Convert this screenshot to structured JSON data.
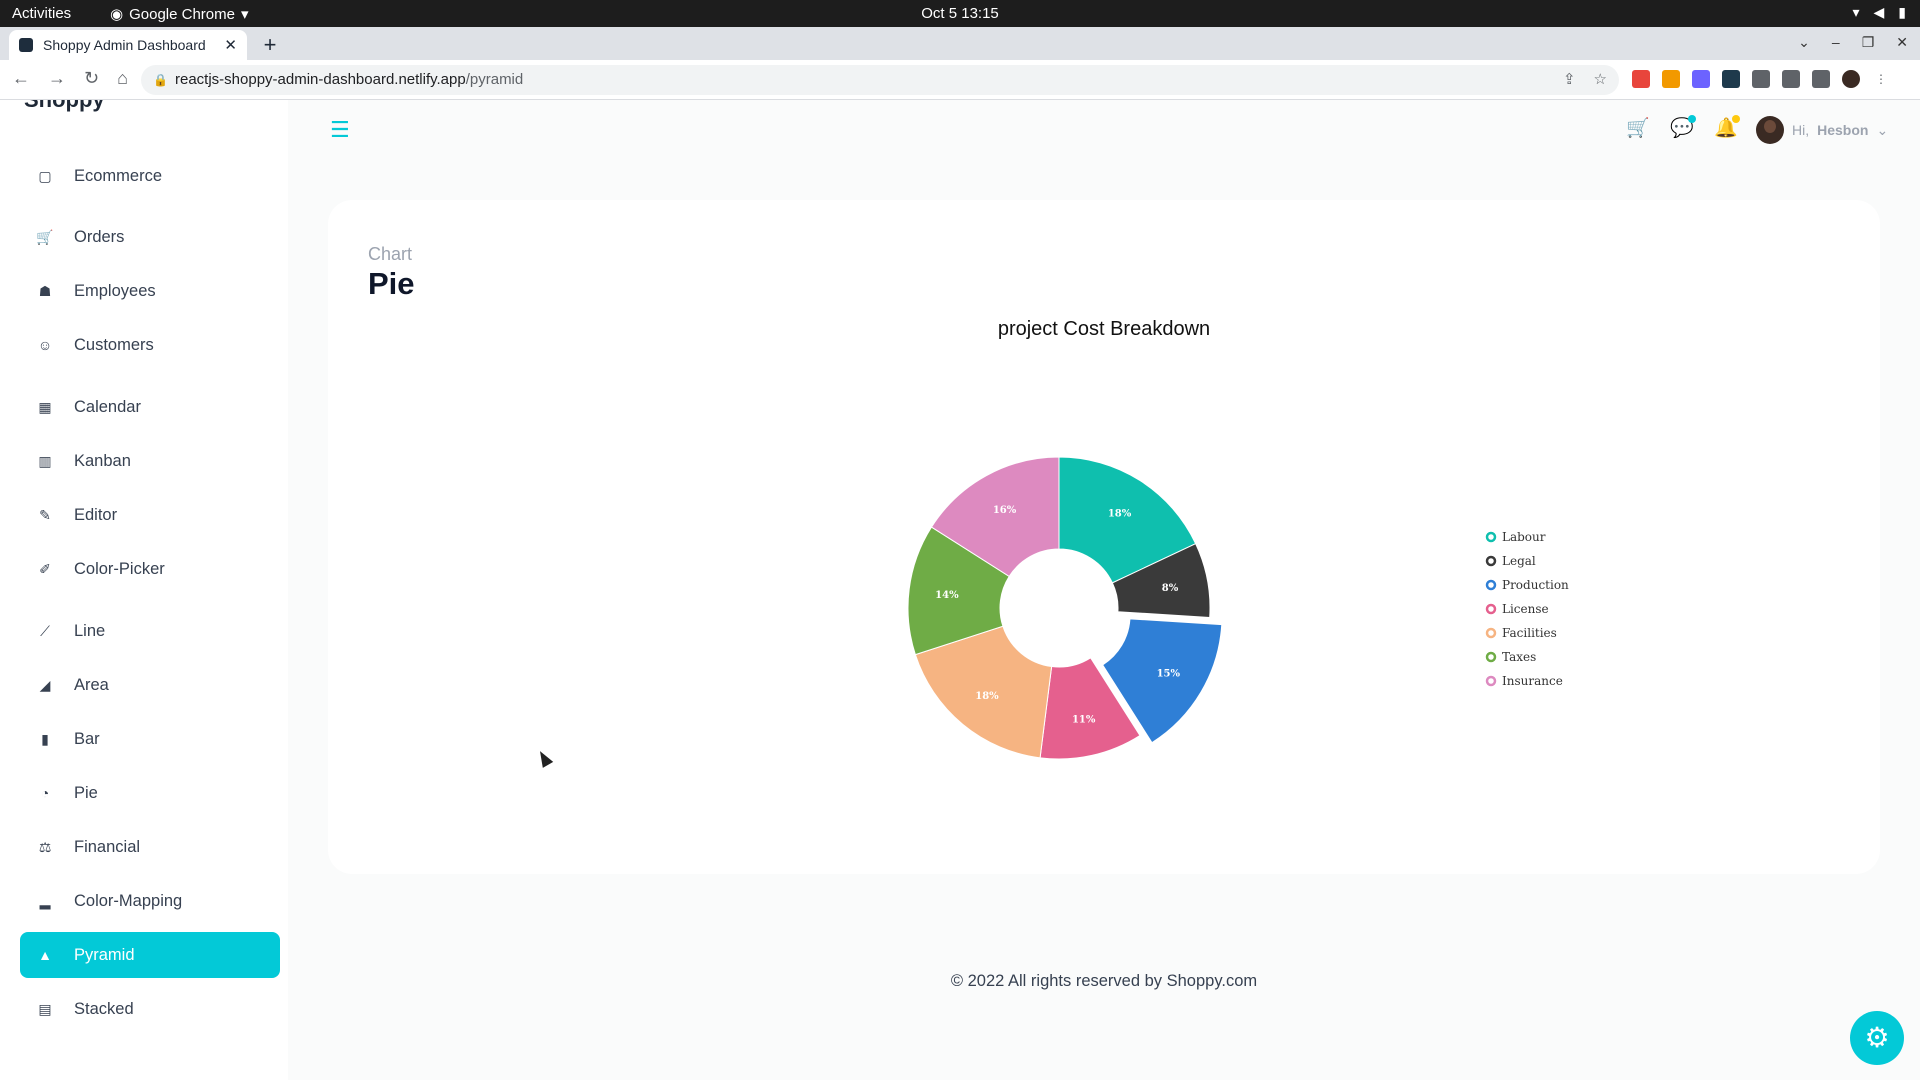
{
  "system": {
    "activities": "Activities",
    "app_name": "Google Chrome",
    "clock": "Oct 5  13:15"
  },
  "browser": {
    "tab_title": "Shoppy Admin Dashboard",
    "url_host": "reactjs-shoppy-admin-dashboard.netlify.app",
    "url_path": "/pyramid"
  },
  "sidebar": {
    "logo": "Shoppy",
    "items": [
      {
        "label": "Ecommerce",
        "icon": "bag-icon"
      },
      {
        "label": "Orders",
        "icon": "cart-icon"
      },
      {
        "label": "Employees",
        "icon": "employees-icon"
      },
      {
        "label": "Customers",
        "icon": "customers-icon"
      },
      {
        "label": "Calendar",
        "icon": "calendar-icon"
      },
      {
        "label": "Kanban",
        "icon": "kanban-icon"
      },
      {
        "label": "Editor",
        "icon": "edit-icon"
      },
      {
        "label": "Color-Picker",
        "icon": "color-picker-icon"
      },
      {
        "label": "Line",
        "icon": "line-chart-icon"
      },
      {
        "label": "Area",
        "icon": "area-chart-icon"
      },
      {
        "label": "Bar",
        "icon": "bar-chart-icon"
      },
      {
        "label": "Pie",
        "icon": "pie-chart-icon"
      },
      {
        "label": "Financial",
        "icon": "financial-icon"
      },
      {
        "label": "Color-Mapping",
        "icon": "color-mapping-icon"
      },
      {
        "label": "Pyramid",
        "icon": "pyramid-icon",
        "active": true
      },
      {
        "label": "Stacked",
        "icon": "stacked-chart-icon"
      }
    ]
  },
  "header": {
    "greeting": "Hi,",
    "user_name": "Hesbon",
    "accent": "#03c9d7"
  },
  "page": {
    "category": "Chart",
    "title": "Pie"
  },
  "chart_data": {
    "type": "pie",
    "title": "project Cost Breakdown",
    "inner_radius": "30%",
    "legend_position": "right",
    "categories": [
      "Labour",
      "Legal",
      "Production",
      "License",
      "Facilities",
      "Taxes",
      "Insurance"
    ],
    "values": [
      18,
      8,
      15,
      11,
      18,
      14,
      16
    ],
    "data_labels": [
      "18%",
      "8%",
      "15%",
      "11%",
      "18%",
      "14%",
      "16%"
    ],
    "colors": [
      "#0fbfae",
      "#3a3a3a",
      "#2f7fd6",
      "#e5608e",
      "#f6b482",
      "#6fac46",
      "#dd8ac0"
    ],
    "exploded": "Production"
  },
  "footer": {
    "text": "© 2022 All rights reserved by Shoppy.com"
  }
}
